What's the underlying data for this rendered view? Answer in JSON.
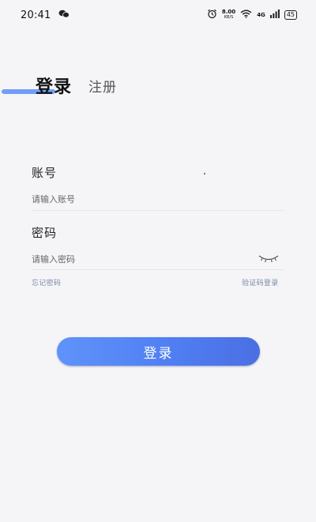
{
  "status_bar": {
    "time": "20:41",
    "net_speed": "8.00",
    "net_speed_unit": "KB/S",
    "network_type": "4G",
    "battery": "45",
    "icons": [
      "wechat-icon",
      "alarm-icon",
      "wifi-icon",
      "signal-icon",
      "battery-icon"
    ]
  },
  "tabs": {
    "login": "登录",
    "register": "注册",
    "active": "login"
  },
  "form": {
    "account_label": "账号",
    "account_placeholder": "请输入账号",
    "account_value": "",
    "password_label": "密码",
    "password_placeholder": "请输入密码",
    "password_value": "",
    "password_visibility_icon": "eye-closed-icon",
    "forgot_password": "忘记密码",
    "code_login": "验证码登录",
    "submit_label": "登录"
  },
  "colors": {
    "accent": "#5b8df8",
    "button_gradient_start": "#5f93fa",
    "button_gradient_end": "#4a6fe3",
    "background": "#f5f5f7",
    "link": "#7a8aa6"
  }
}
